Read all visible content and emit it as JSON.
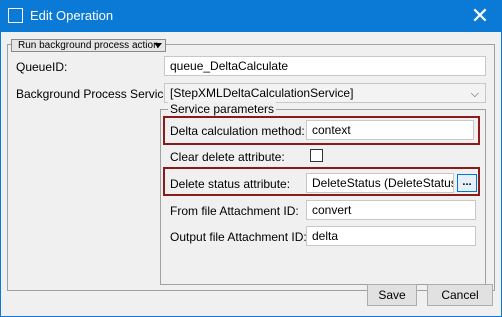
{
  "window": {
    "title": "Edit Operation",
    "close_glyph": "✕"
  },
  "action_dropdown": {
    "label": "Run background process action"
  },
  "queue": {
    "label": "QueueID:",
    "value": "queue_DeltaCalculate"
  },
  "service": {
    "label": "Background Process Service:",
    "value": "[StepXMLDeltaCalculationService]"
  },
  "params": {
    "legend": "Service parameters",
    "delta_method": {
      "label": "Delta calculation method:",
      "value": "context"
    },
    "clear_delete": {
      "label": "Clear delete attribute:",
      "checked": false
    },
    "delete_status": {
      "label": "Delete status attribute:",
      "value": "DeleteStatus (DeleteStatus)",
      "browse": "..."
    },
    "from_file": {
      "label": "From file Attachment ID:",
      "value": "convert"
    },
    "output_file": {
      "label": "Output file Attachment ID:",
      "value": "delta"
    }
  },
  "buttons": {
    "save": "Save",
    "cancel": "Cancel"
  },
  "colors": {
    "title_bar": "#0a7ad6",
    "highlight": "#8b1a1a",
    "dialog_bg": "#f0f0f0"
  }
}
